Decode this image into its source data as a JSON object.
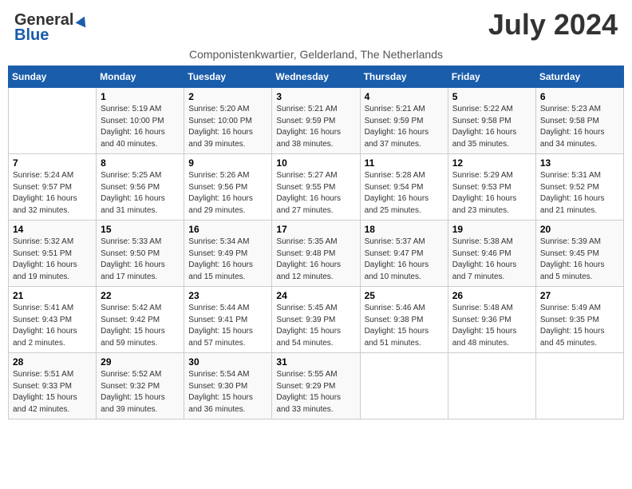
{
  "header": {
    "logo_general": "General",
    "logo_blue": "Blue",
    "month_title": "July 2024",
    "subtitle": "Componistenkwartier, Gelderland, The Netherlands"
  },
  "calendar": {
    "days_of_week": [
      "Sunday",
      "Monday",
      "Tuesday",
      "Wednesday",
      "Thursday",
      "Friday",
      "Saturday"
    ],
    "weeks": [
      [
        {
          "day": "",
          "info": ""
        },
        {
          "day": "1",
          "info": "Sunrise: 5:19 AM\nSunset: 10:00 PM\nDaylight: 16 hours\nand 40 minutes."
        },
        {
          "day": "2",
          "info": "Sunrise: 5:20 AM\nSunset: 10:00 PM\nDaylight: 16 hours\nand 39 minutes."
        },
        {
          "day": "3",
          "info": "Sunrise: 5:21 AM\nSunset: 9:59 PM\nDaylight: 16 hours\nand 38 minutes."
        },
        {
          "day": "4",
          "info": "Sunrise: 5:21 AM\nSunset: 9:59 PM\nDaylight: 16 hours\nand 37 minutes."
        },
        {
          "day": "5",
          "info": "Sunrise: 5:22 AM\nSunset: 9:58 PM\nDaylight: 16 hours\nand 35 minutes."
        },
        {
          "day": "6",
          "info": "Sunrise: 5:23 AM\nSunset: 9:58 PM\nDaylight: 16 hours\nand 34 minutes."
        }
      ],
      [
        {
          "day": "7",
          "info": "Sunrise: 5:24 AM\nSunset: 9:57 PM\nDaylight: 16 hours\nand 32 minutes."
        },
        {
          "day": "8",
          "info": "Sunrise: 5:25 AM\nSunset: 9:56 PM\nDaylight: 16 hours\nand 31 minutes."
        },
        {
          "day": "9",
          "info": "Sunrise: 5:26 AM\nSunset: 9:56 PM\nDaylight: 16 hours\nand 29 minutes."
        },
        {
          "day": "10",
          "info": "Sunrise: 5:27 AM\nSunset: 9:55 PM\nDaylight: 16 hours\nand 27 minutes."
        },
        {
          "day": "11",
          "info": "Sunrise: 5:28 AM\nSunset: 9:54 PM\nDaylight: 16 hours\nand 25 minutes."
        },
        {
          "day": "12",
          "info": "Sunrise: 5:29 AM\nSunset: 9:53 PM\nDaylight: 16 hours\nand 23 minutes."
        },
        {
          "day": "13",
          "info": "Sunrise: 5:31 AM\nSunset: 9:52 PM\nDaylight: 16 hours\nand 21 minutes."
        }
      ],
      [
        {
          "day": "14",
          "info": "Sunrise: 5:32 AM\nSunset: 9:51 PM\nDaylight: 16 hours\nand 19 minutes."
        },
        {
          "day": "15",
          "info": "Sunrise: 5:33 AM\nSunset: 9:50 PM\nDaylight: 16 hours\nand 17 minutes."
        },
        {
          "day": "16",
          "info": "Sunrise: 5:34 AM\nSunset: 9:49 PM\nDaylight: 16 hours\nand 15 minutes."
        },
        {
          "day": "17",
          "info": "Sunrise: 5:35 AM\nSunset: 9:48 PM\nDaylight: 16 hours\nand 12 minutes."
        },
        {
          "day": "18",
          "info": "Sunrise: 5:37 AM\nSunset: 9:47 PM\nDaylight: 16 hours\nand 10 minutes."
        },
        {
          "day": "19",
          "info": "Sunrise: 5:38 AM\nSunset: 9:46 PM\nDaylight: 16 hours\nand 7 minutes."
        },
        {
          "day": "20",
          "info": "Sunrise: 5:39 AM\nSunset: 9:45 PM\nDaylight: 16 hours\nand 5 minutes."
        }
      ],
      [
        {
          "day": "21",
          "info": "Sunrise: 5:41 AM\nSunset: 9:43 PM\nDaylight: 16 hours\nand 2 minutes."
        },
        {
          "day": "22",
          "info": "Sunrise: 5:42 AM\nSunset: 9:42 PM\nDaylight: 15 hours\nand 59 minutes."
        },
        {
          "day": "23",
          "info": "Sunrise: 5:44 AM\nSunset: 9:41 PM\nDaylight: 15 hours\nand 57 minutes."
        },
        {
          "day": "24",
          "info": "Sunrise: 5:45 AM\nSunset: 9:39 PM\nDaylight: 15 hours\nand 54 minutes."
        },
        {
          "day": "25",
          "info": "Sunrise: 5:46 AM\nSunset: 9:38 PM\nDaylight: 15 hours\nand 51 minutes."
        },
        {
          "day": "26",
          "info": "Sunrise: 5:48 AM\nSunset: 9:36 PM\nDaylight: 15 hours\nand 48 minutes."
        },
        {
          "day": "27",
          "info": "Sunrise: 5:49 AM\nSunset: 9:35 PM\nDaylight: 15 hours\nand 45 minutes."
        }
      ],
      [
        {
          "day": "28",
          "info": "Sunrise: 5:51 AM\nSunset: 9:33 PM\nDaylight: 15 hours\nand 42 minutes."
        },
        {
          "day": "29",
          "info": "Sunrise: 5:52 AM\nSunset: 9:32 PM\nDaylight: 15 hours\nand 39 minutes."
        },
        {
          "day": "30",
          "info": "Sunrise: 5:54 AM\nSunset: 9:30 PM\nDaylight: 15 hours\nand 36 minutes."
        },
        {
          "day": "31",
          "info": "Sunrise: 5:55 AM\nSunset: 9:29 PM\nDaylight: 15 hours\nand 33 minutes."
        },
        {
          "day": "",
          "info": ""
        },
        {
          "day": "",
          "info": ""
        },
        {
          "day": "",
          "info": ""
        }
      ]
    ]
  }
}
